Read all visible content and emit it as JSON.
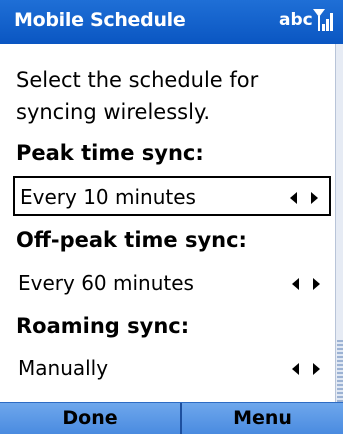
{
  "titlebar": {
    "title": "Mobile Schedule",
    "input_mode": "abc",
    "signal_icon": "signal-strength-icon"
  },
  "content": {
    "intro_line1": "Select the schedule for",
    "intro_line2": "syncing wirelessly.",
    "peak": {
      "label": "Peak time sync:",
      "value": "Every 10 minutes"
    },
    "offpeak": {
      "label": "Off-peak time sync:",
      "value": "Every 60 minutes"
    },
    "roaming": {
      "label": "Roaming sync:",
      "value": "Manually"
    }
  },
  "softkeys": {
    "left": "Done",
    "right": "Menu"
  },
  "colors": {
    "title_bar": "#0a56c2",
    "softkey_bar": "#4a8be0",
    "text": "#000000"
  }
}
